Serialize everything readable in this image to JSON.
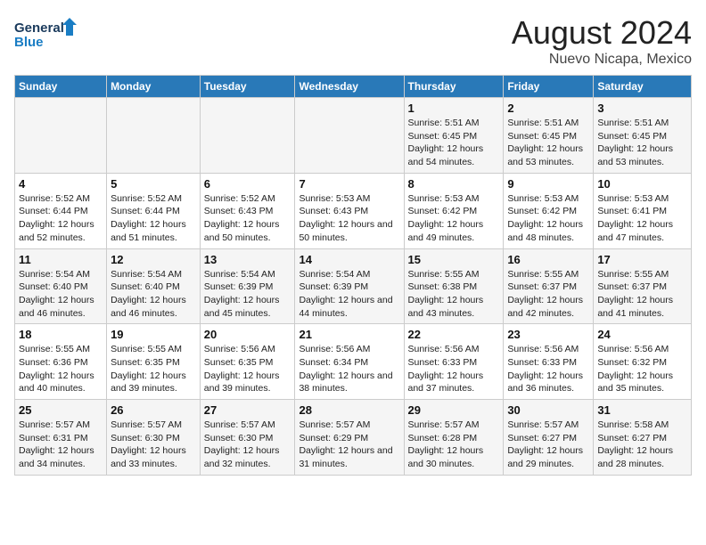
{
  "logo": {
    "line1": "General",
    "line2": "Blue"
  },
  "title": "August 2024",
  "subtitle": "Nuevo Nicapa, Mexico",
  "days_of_week": [
    "Sunday",
    "Monday",
    "Tuesday",
    "Wednesday",
    "Thursday",
    "Friday",
    "Saturday"
  ],
  "weeks": [
    [
      {
        "day": "",
        "info": ""
      },
      {
        "day": "",
        "info": ""
      },
      {
        "day": "",
        "info": ""
      },
      {
        "day": "",
        "info": ""
      },
      {
        "day": "1",
        "info": "Sunrise: 5:51 AM\nSunset: 6:45 PM\nDaylight: 12 hours\nand 54 minutes."
      },
      {
        "day": "2",
        "info": "Sunrise: 5:51 AM\nSunset: 6:45 PM\nDaylight: 12 hours\nand 53 minutes."
      },
      {
        "day": "3",
        "info": "Sunrise: 5:51 AM\nSunset: 6:45 PM\nDaylight: 12 hours\nand 53 minutes."
      }
    ],
    [
      {
        "day": "4",
        "info": "Sunrise: 5:52 AM\nSunset: 6:44 PM\nDaylight: 12 hours\nand 52 minutes."
      },
      {
        "day": "5",
        "info": "Sunrise: 5:52 AM\nSunset: 6:44 PM\nDaylight: 12 hours\nand 51 minutes."
      },
      {
        "day": "6",
        "info": "Sunrise: 5:52 AM\nSunset: 6:43 PM\nDaylight: 12 hours\nand 50 minutes."
      },
      {
        "day": "7",
        "info": "Sunrise: 5:53 AM\nSunset: 6:43 PM\nDaylight: 12 hours\nand 50 minutes."
      },
      {
        "day": "8",
        "info": "Sunrise: 5:53 AM\nSunset: 6:42 PM\nDaylight: 12 hours\nand 49 minutes."
      },
      {
        "day": "9",
        "info": "Sunrise: 5:53 AM\nSunset: 6:42 PM\nDaylight: 12 hours\nand 48 minutes."
      },
      {
        "day": "10",
        "info": "Sunrise: 5:53 AM\nSunset: 6:41 PM\nDaylight: 12 hours\nand 47 minutes."
      }
    ],
    [
      {
        "day": "11",
        "info": "Sunrise: 5:54 AM\nSunset: 6:40 PM\nDaylight: 12 hours\nand 46 minutes."
      },
      {
        "day": "12",
        "info": "Sunrise: 5:54 AM\nSunset: 6:40 PM\nDaylight: 12 hours\nand 46 minutes."
      },
      {
        "day": "13",
        "info": "Sunrise: 5:54 AM\nSunset: 6:39 PM\nDaylight: 12 hours\nand 45 minutes."
      },
      {
        "day": "14",
        "info": "Sunrise: 5:54 AM\nSunset: 6:39 PM\nDaylight: 12 hours\nand 44 minutes."
      },
      {
        "day": "15",
        "info": "Sunrise: 5:55 AM\nSunset: 6:38 PM\nDaylight: 12 hours\nand 43 minutes."
      },
      {
        "day": "16",
        "info": "Sunrise: 5:55 AM\nSunset: 6:37 PM\nDaylight: 12 hours\nand 42 minutes."
      },
      {
        "day": "17",
        "info": "Sunrise: 5:55 AM\nSunset: 6:37 PM\nDaylight: 12 hours\nand 41 minutes."
      }
    ],
    [
      {
        "day": "18",
        "info": "Sunrise: 5:55 AM\nSunset: 6:36 PM\nDaylight: 12 hours\nand 40 minutes."
      },
      {
        "day": "19",
        "info": "Sunrise: 5:55 AM\nSunset: 6:35 PM\nDaylight: 12 hours\nand 39 minutes."
      },
      {
        "day": "20",
        "info": "Sunrise: 5:56 AM\nSunset: 6:35 PM\nDaylight: 12 hours\nand 39 minutes."
      },
      {
        "day": "21",
        "info": "Sunrise: 5:56 AM\nSunset: 6:34 PM\nDaylight: 12 hours\nand 38 minutes."
      },
      {
        "day": "22",
        "info": "Sunrise: 5:56 AM\nSunset: 6:33 PM\nDaylight: 12 hours\nand 37 minutes."
      },
      {
        "day": "23",
        "info": "Sunrise: 5:56 AM\nSunset: 6:33 PM\nDaylight: 12 hours\nand 36 minutes."
      },
      {
        "day": "24",
        "info": "Sunrise: 5:56 AM\nSunset: 6:32 PM\nDaylight: 12 hours\nand 35 minutes."
      }
    ],
    [
      {
        "day": "25",
        "info": "Sunrise: 5:57 AM\nSunset: 6:31 PM\nDaylight: 12 hours\nand 34 minutes."
      },
      {
        "day": "26",
        "info": "Sunrise: 5:57 AM\nSunset: 6:30 PM\nDaylight: 12 hours\nand 33 minutes."
      },
      {
        "day": "27",
        "info": "Sunrise: 5:57 AM\nSunset: 6:30 PM\nDaylight: 12 hours\nand 32 minutes."
      },
      {
        "day": "28",
        "info": "Sunrise: 5:57 AM\nSunset: 6:29 PM\nDaylight: 12 hours\nand 31 minutes."
      },
      {
        "day": "29",
        "info": "Sunrise: 5:57 AM\nSunset: 6:28 PM\nDaylight: 12 hours\nand 30 minutes."
      },
      {
        "day": "30",
        "info": "Sunrise: 5:57 AM\nSunset: 6:27 PM\nDaylight: 12 hours\nand 29 minutes."
      },
      {
        "day": "31",
        "info": "Sunrise: 5:58 AM\nSunset: 6:27 PM\nDaylight: 12 hours\nand 28 minutes."
      }
    ]
  ]
}
